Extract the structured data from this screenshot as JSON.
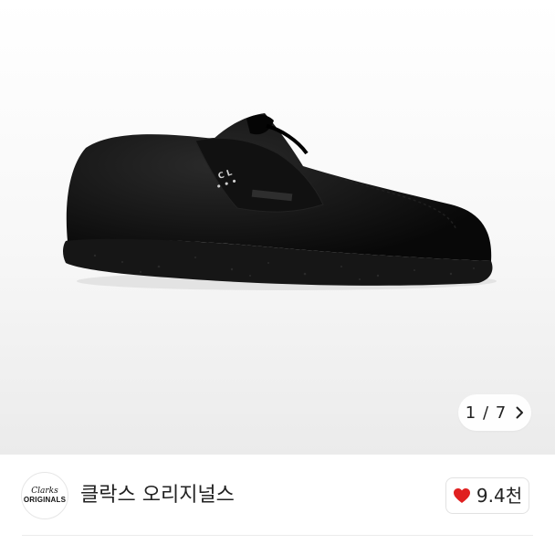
{
  "gallery": {
    "image_icon": "product-photo-black-suede-shoe",
    "pager_current": "1",
    "pager_separator": "/",
    "pager_total": "7",
    "next_icon": "chevron-right-icon"
  },
  "seller": {
    "logo_line1": "Clarks",
    "logo_line2": "ORIGINALS",
    "name": "클락스 오리지널스",
    "like_icon": "heart-icon",
    "like_color": "#e02020",
    "like_count": "9.4천"
  }
}
